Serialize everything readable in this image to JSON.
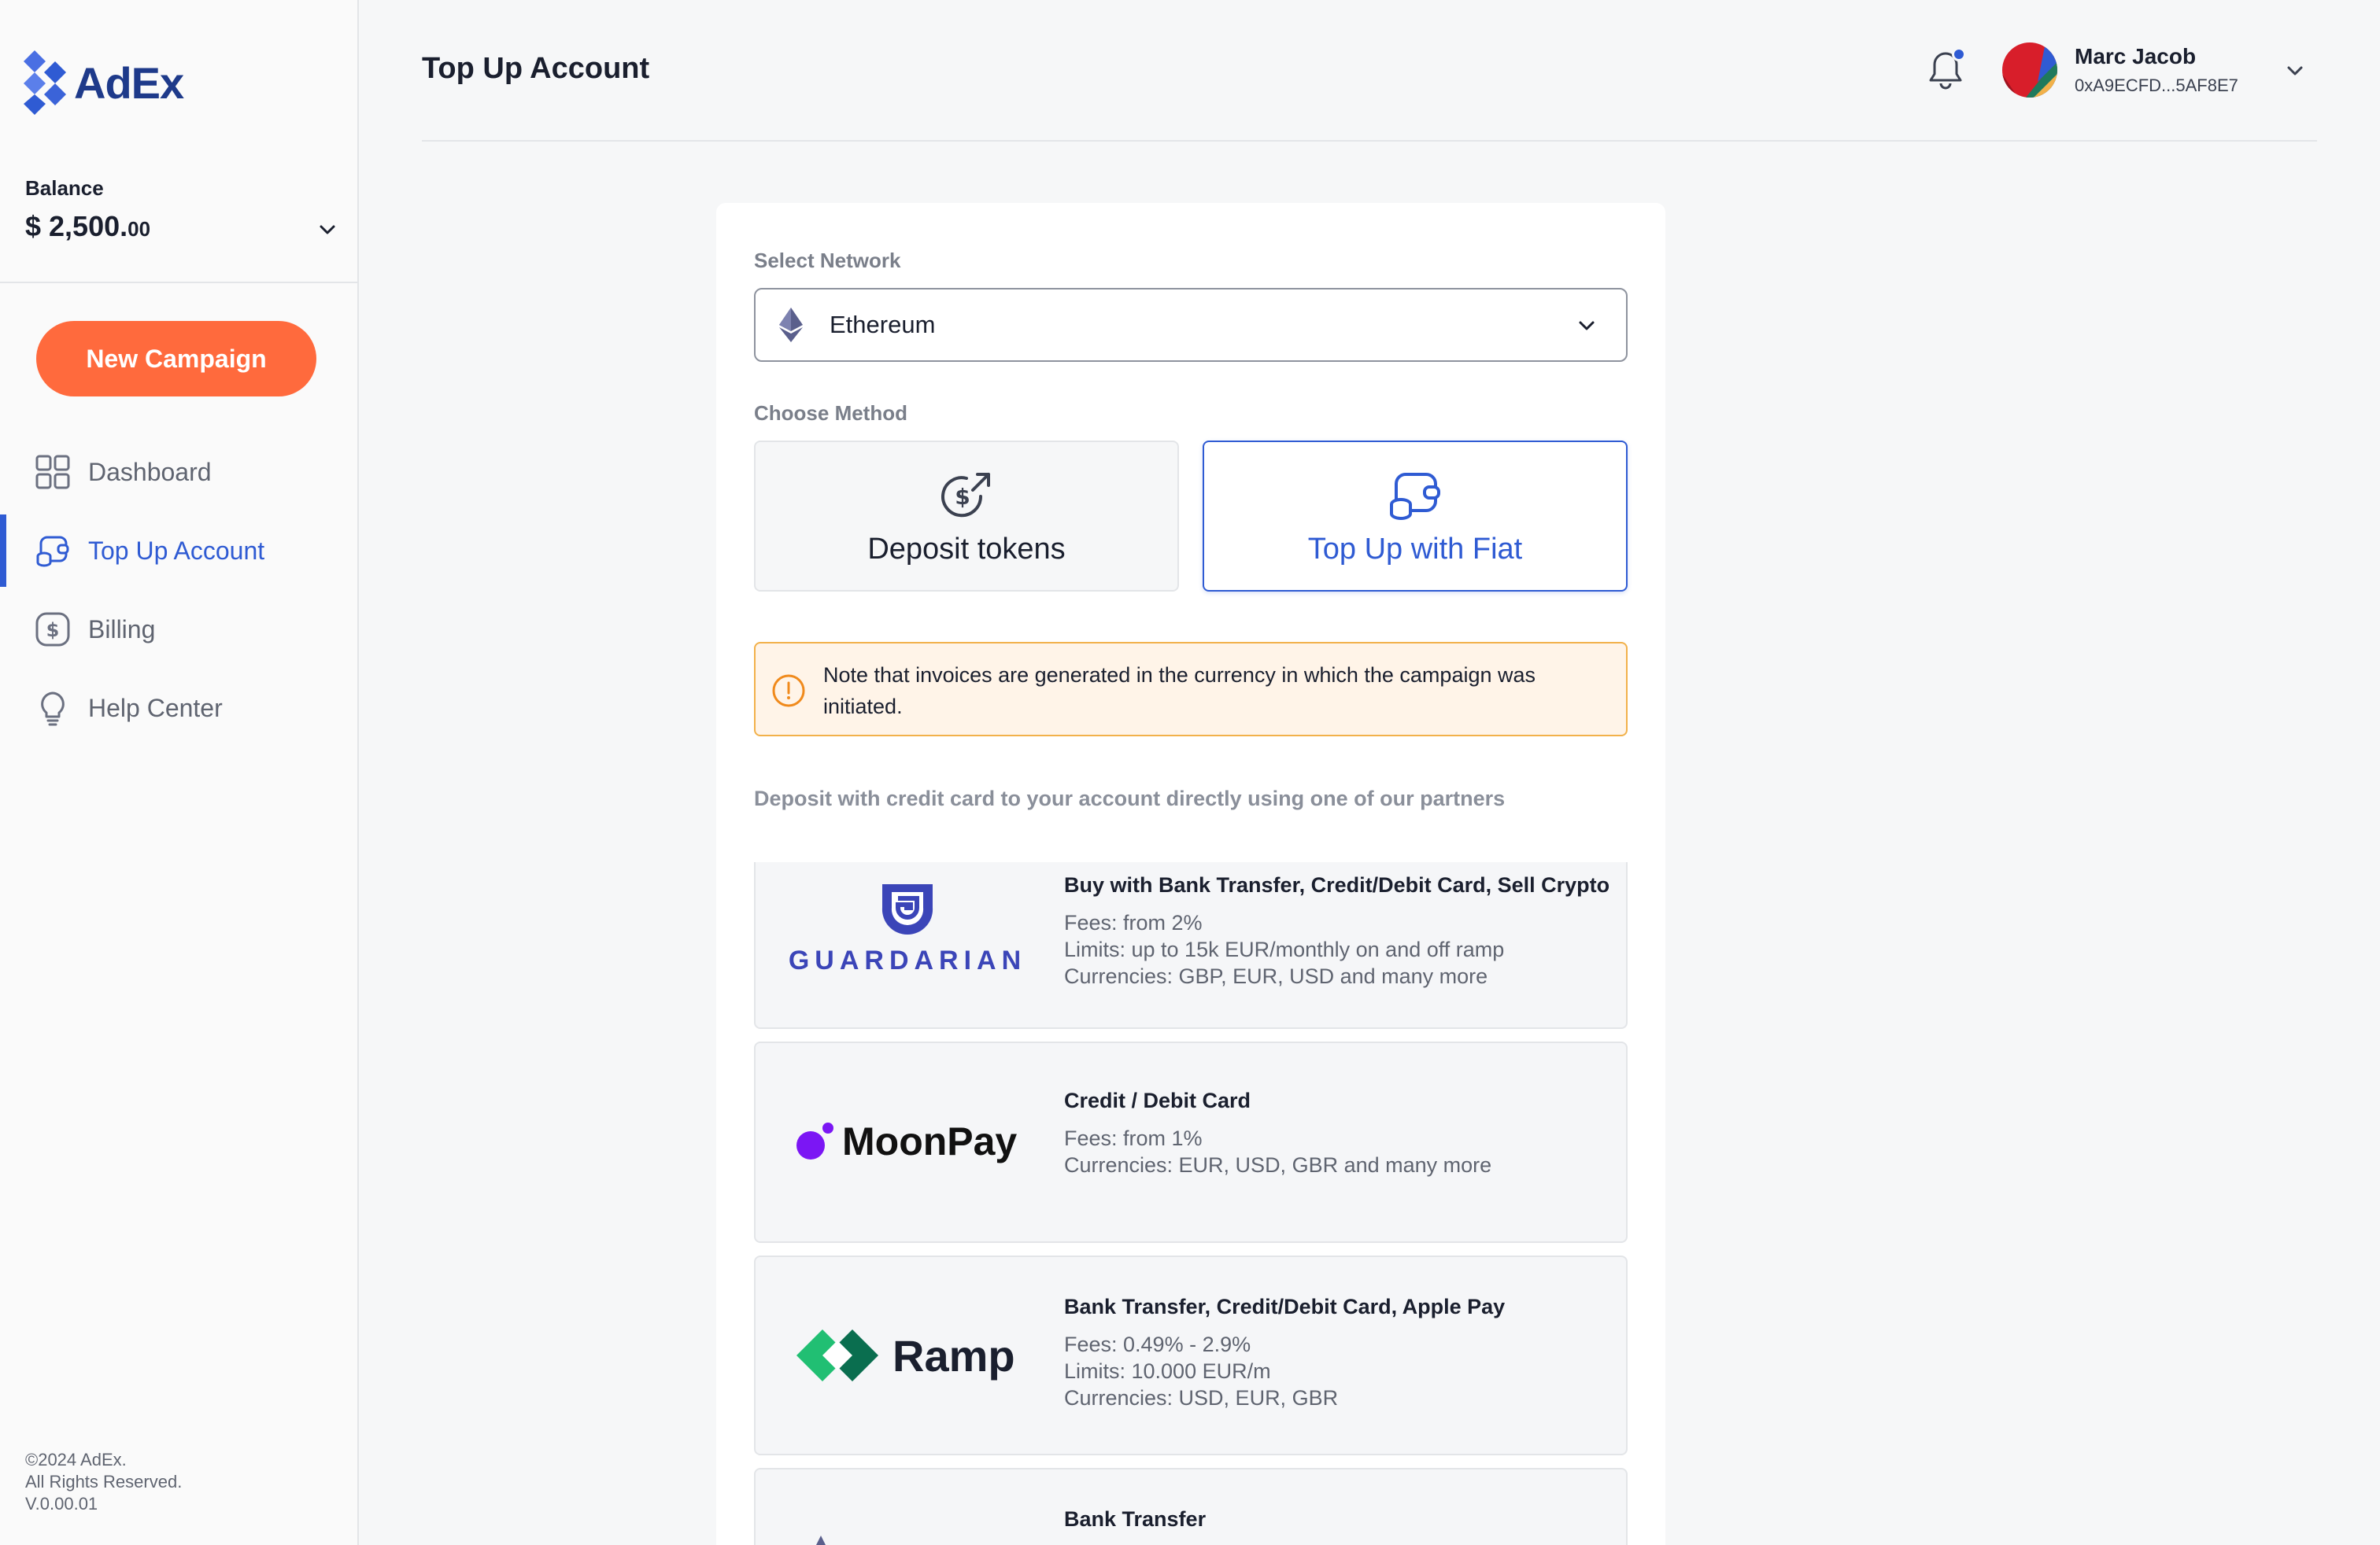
{
  "app": {
    "name": "AdEx"
  },
  "sidebar": {
    "balance_label": "Balance",
    "balance_main": "$ 2,500.",
    "balance_cents": "00",
    "new_campaign": "New Campaign",
    "items": [
      {
        "label": "Dashboard",
        "icon": "grid-icon",
        "active": false
      },
      {
        "label": "Top Up Account",
        "icon": "wallet-coins-icon",
        "active": true
      },
      {
        "label": "Billing",
        "icon": "dollar-icon",
        "active": false
      },
      {
        "label": "Help Center",
        "icon": "lightbulb-icon",
        "active": false
      }
    ],
    "footer": [
      "©2024 AdEx.",
      "All Rights Reserved.",
      "V.0.00.01"
    ]
  },
  "header": {
    "title": "Top Up Account",
    "user_name": "Marc Jacob",
    "user_address": "0xA9ECFD...5AF8E7",
    "has_notification": true
  },
  "form": {
    "network_label": "Select Network",
    "network_value": "Ethereum",
    "method_label": "Choose Method",
    "methods": [
      {
        "label": "Deposit tokens",
        "selected": false
      },
      {
        "label": "Top Up with Fiat",
        "selected": true
      }
    ],
    "note": "Note that invoices are generated in the currency in which the campaign was initiated.",
    "partners_intro": "Deposit with credit card to your account directly using one of our partners"
  },
  "partners": [
    {
      "name": "GUARDARIAN",
      "title": "Buy with Bank Transfer, Credit/Debit Card, Sell Crypto",
      "lines": [
        "Fees: from 2%",
        "Limits: up to 15k EUR/monthly on and off ramp",
        "Currencies: GBP, EUR, USD and many more"
      ]
    },
    {
      "name": "MoonPay",
      "title": "Credit / Debit Card",
      "lines": [
        "Fees: from 1%",
        "Currencies: EUR, USD, GBR and many more"
      ]
    },
    {
      "name": "Ramp",
      "title": "Bank Transfer, Credit/Debit Card, Apple Pay",
      "lines": [
        "Fees: 0.49% - 2.9%",
        "Limits: 10.000 EUR/m",
        "Currencies: USD, EUR, GBR"
      ]
    },
    {
      "name": "",
      "title": "Bank Transfer",
      "lines": []
    }
  ],
  "colors": {
    "accent": "#2F5BD3",
    "cta": "#FF6A3D",
    "warning_border": "#F2B14A",
    "warning_bg": "#FFF4E8",
    "brand_navy": "#1E3A8A"
  }
}
